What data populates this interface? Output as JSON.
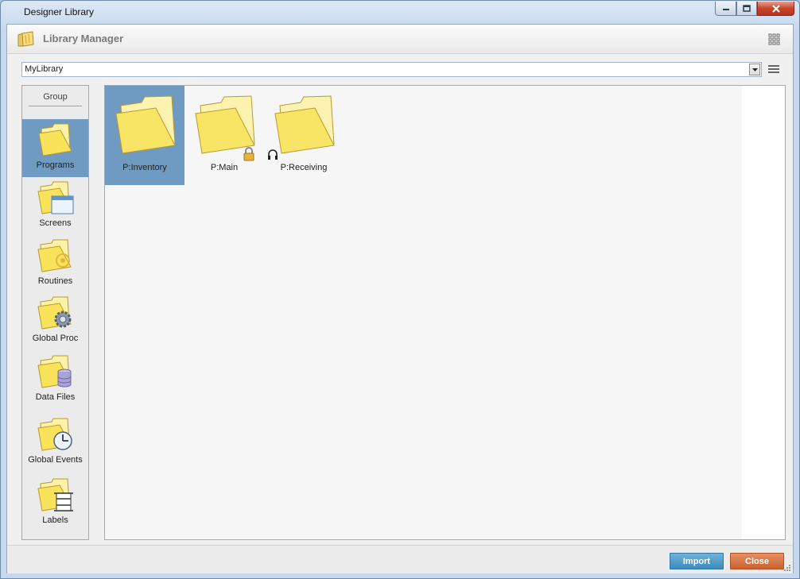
{
  "window": {
    "title": "Designer Library"
  },
  "header": {
    "title": "Library Manager"
  },
  "library_select": {
    "value": "MyLibrary"
  },
  "sidebar": {
    "group_label": "Group",
    "items": [
      {
        "label": "Programs",
        "icon": "folder-icon",
        "selected": true
      },
      {
        "label": "Screens",
        "icon": "screens-folder-icon"
      },
      {
        "label": "Routines",
        "icon": "routines-folder-icon"
      },
      {
        "label": "Global Proc",
        "icon": "global-proc-folder-icon"
      },
      {
        "label": "Data Files",
        "icon": "data-files-folder-icon"
      },
      {
        "label": "Global Events",
        "icon": "global-events-folder-icon"
      },
      {
        "label": "Labels",
        "icon": "labels-folder-icon"
      }
    ]
  },
  "items": [
    {
      "label": "P:Inventory",
      "selected": true,
      "badge": ""
    },
    {
      "label": "P:Main",
      "badge": "lock-icon"
    },
    {
      "label": "P:Receiving",
      "badge": "headset-icon"
    }
  ],
  "footer": {
    "import_label": "Import",
    "close_label": "Close"
  },
  "colors": {
    "selection": "#6f9ac1",
    "import": "#3c8bbf",
    "close": "#c9612f"
  }
}
